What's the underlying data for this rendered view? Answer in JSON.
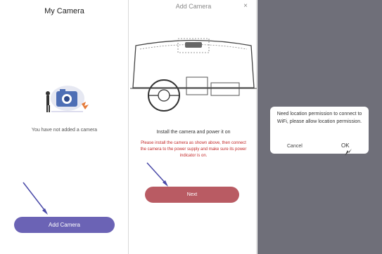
{
  "screen1": {
    "title": "My Camera",
    "empty_text": "You have not added a camera",
    "add_button": "Add Camera"
  },
  "screen2": {
    "title": "Add Camera",
    "close": "×",
    "instruction_title": "Install the camera and power it on",
    "instruction_text": "Please install the camera as shown above, then connect the camera to the power supply and make sure its power indicator is on.",
    "next_button": "Next"
  },
  "screen3": {
    "dialog_message": "Need location permission to connect to WiFi, please allow location permission.",
    "cancel_button": "Cancel",
    "ok_button": "OK"
  },
  "colors": {
    "primary": "#6b63b5",
    "next": "#b95b63",
    "warning_text": "#c42a2a",
    "overlay": "#6f6f79"
  }
}
